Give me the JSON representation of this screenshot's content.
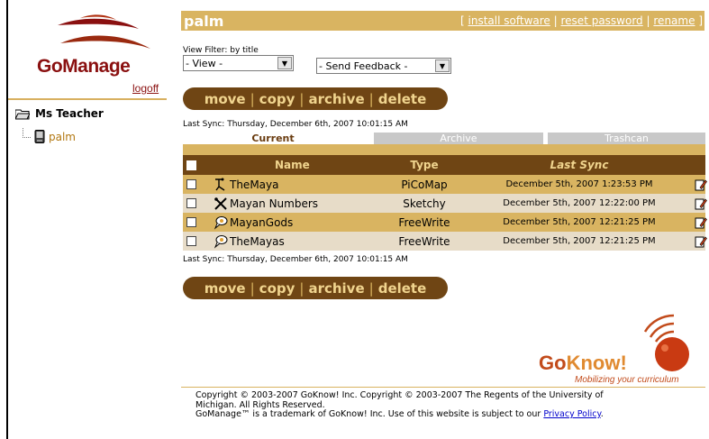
{
  "app": {
    "logo_text": "GoManage",
    "logoff_label": "logoff"
  },
  "tree": {
    "root_label": "Ms Teacher",
    "child_label": "palm"
  },
  "header": {
    "title": "palm",
    "link_open": "[",
    "link_install": "install software",
    "link_sep": "|",
    "link_reset": "reset password",
    "link_rename": "rename",
    "link_close": "]"
  },
  "filters": {
    "view_label": "View Filter: by title",
    "view_value": "- View -",
    "feedback_value": "- Send Feedback -"
  },
  "actions": {
    "move": "move",
    "copy": "copy",
    "archive": "archive",
    "delete": "delete",
    "sep": "|"
  },
  "sync": {
    "text": "Last Sync: Thursday, December 6th, 2007 10:01:15 AM"
  },
  "tabs": {
    "current": "Current",
    "archive": "Archive",
    "trash": "Trashcan"
  },
  "table": {
    "columns": {
      "name": "Name",
      "type": "Type",
      "last_sync": "Last Sync"
    },
    "rows": [
      {
        "name": "TheMaya",
        "type": "PiCoMap",
        "last_sync": "December 5th, 2007 1:23:53 PM",
        "icon": "picomap-icon"
      },
      {
        "name": "Mayan Numbers",
        "type": "Sketchy",
        "last_sync": "December 5th, 2007 12:22:00 PM",
        "icon": "sketchy-icon"
      },
      {
        "name": "MayanGods",
        "type": "FreeWrite",
        "last_sync": "December 5th, 2007 12:21:25 PM",
        "icon": "freewrite-icon"
      },
      {
        "name": "TheMayas",
        "type": "FreeWrite",
        "last_sync": "December 5th, 2007 12:21:25 PM",
        "icon": "freewrite-icon"
      }
    ]
  },
  "brand": {
    "goknow_go": "Go",
    "goknow_know": "Know!",
    "tagline": "Mobilizing your curriculum"
  },
  "footer": {
    "line1": "Copyright © 2003-2007 GoKnow! Inc. Copyright © 2003-2007 The Regents of the University of",
    "line2": "Michigan. All Rights Reserved.",
    "line3": "GoManage™ is a trademark of GoKnow! Inc. Use of this website is subject to our",
    "privacy_link": "Privacy Policy",
    "period": "."
  },
  "colors": {
    "brand_red": "#8a1010",
    "tan": "#d9b461",
    "brown": "#6f4514"
  }
}
